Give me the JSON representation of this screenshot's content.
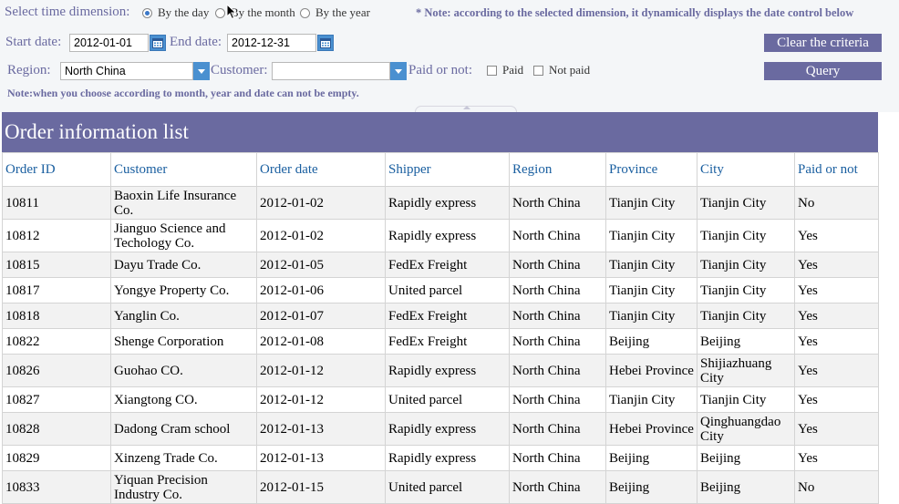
{
  "filters": {
    "time_dimension_label": "Select time dimension:",
    "options": [
      "By the day",
      "By the month",
      "By the year"
    ],
    "selected_option": "By the day",
    "dimension_note": "* Note: according to the selected dimension, it dynamically displays the date control below",
    "start_date_label": "Start date:",
    "start_date_value": "2012-01-01",
    "end_date_label": "End date:",
    "end_date_value": "2012-12-31",
    "region_label": "Region:",
    "region_value": "North China",
    "customer_label": "Customer:",
    "customer_value": "",
    "paid_label": "Paid or not:",
    "paid_option": "Paid",
    "not_paid_option": "Not paid",
    "month_note": "Note:when you choose according to month, year and date can not be empty.",
    "clear_button": "Clear the criteria",
    "query_button": "Query"
  },
  "list": {
    "title": "Order information list",
    "columns": [
      "Order ID",
      "Customer",
      "Order date",
      "Shipper",
      "Region",
      "Province",
      "City",
      "Paid or not"
    ],
    "rows": [
      [
        "10811",
        "Baoxin Life Insurance Co.",
        "2012-01-02",
        "Rapidly express",
        "North China",
        "Tianjin City",
        "Tianjin City",
        "No"
      ],
      [
        "10812",
        "Jianguo Science and Techology Co.",
        "2012-01-02",
        "Rapidly express",
        "North China",
        "Tianjin City",
        "Tianjin City",
        "Yes"
      ],
      [
        "10815",
        "Dayu Trade Co.",
        "2012-01-05",
        "FedEx Freight",
        "North China",
        "Tianjin City",
        "Tianjin City",
        "Yes"
      ],
      [
        "10817",
        "Yongye Property Co.",
        "2012-01-06",
        "United parcel",
        "North China",
        "Tianjin City",
        "Tianjin City",
        "Yes"
      ],
      [
        "10818",
        "Yanglin Co.",
        "2012-01-07",
        "FedEx Freight",
        "North China",
        "Tianjin City",
        "Tianjin City",
        "Yes"
      ],
      [
        "10822",
        "Shenge Corporation",
        "2012-01-08",
        "FedEx Freight",
        "North China",
        "Beijing",
        "Beijing",
        "Yes"
      ],
      [
        "10826",
        "Guohao CO.",
        "2012-01-12",
        "Rapidly express",
        "North China",
        "Hebei Province",
        "Shijiazhuang City",
        "Yes"
      ],
      [
        "10827",
        "Xiangtong CO.",
        "2012-01-12",
        "United parcel",
        "North China",
        "Tianjin City",
        "Tianjin City",
        "Yes"
      ],
      [
        "10828",
        "Dadong Cram school",
        "2012-01-13",
        "Rapidly express",
        "North China",
        "Hebei Province",
        "Qinghuangdao City",
        "Yes"
      ],
      [
        "10829",
        "Xinzeng Trade Co.",
        "2012-01-13",
        "Rapidly express",
        "North China",
        "Beijing",
        "Beijing",
        "Yes"
      ],
      [
        "10833",
        "Yiquan Precision Industry Co.",
        "2012-01-15",
        "United parcel",
        "North China",
        "Beijing",
        "Beijing",
        "No"
      ]
    ]
  },
  "icons": {
    "calendar": "calendar-icon",
    "dropdown": "chevron-down-icon",
    "cursor": "mouse-pointer-icon"
  },
  "colors": {
    "accent": "#6a6aa0",
    "header_text": "#1a5fa0",
    "control_blue": "#4a90d0"
  }
}
